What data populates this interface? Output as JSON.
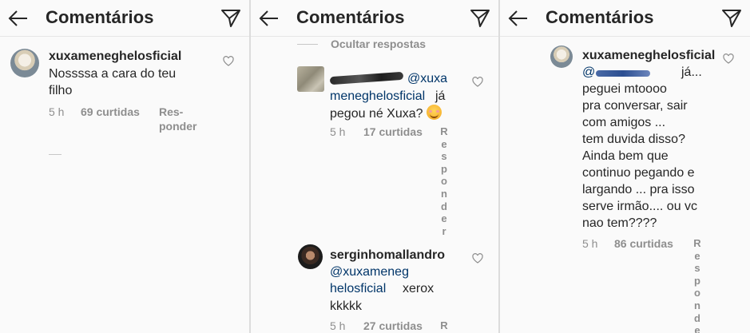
{
  "header": {
    "title": "Comentários"
  },
  "panel1": {
    "username": "xuxameneghelosficial",
    "text_lines": [
      "Nossssa a cara do teu",
      "filho"
    ],
    "time": "5 h",
    "likes": "69 curtidas",
    "reply_lines": [
      "Res-",
      "ponder"
    ]
  },
  "panel2": {
    "hide_replies": "Ocultar respostas",
    "reply1": {
      "mention_line1": "@xuxa",
      "mention_line2": "meneghelosficial",
      "tail": "já",
      "line3": "pegou né Xuxa?",
      "time": "5 h",
      "likes": "17 curtidas",
      "reply_label": "Responder"
    },
    "reply2": {
      "username": "serginhomallandro",
      "mention_line1": "@xuxameneg",
      "mention_line2": "helosficial",
      "tail": "xerox",
      "line4": "kkkkk",
      "time": "5 h",
      "likes": "27 curtidas",
      "reply_label": "R"
    }
  },
  "panel3": {
    "username": "xuxameneghelosficial",
    "mention": "@",
    "first_tail": "já...",
    "text_lines": [
      "peguei mtoooo",
      "pra conversar, sair",
      "com amigos ...",
      "tem duvida disso?",
      "Ainda bem que",
      "continuo pegando e",
      "largando ... pra isso",
      "serve irmão.... ou vc",
      "nao tem????"
    ],
    "time": "5 h",
    "likes": "86 curtidas",
    "reply_label": "Responder"
  }
}
